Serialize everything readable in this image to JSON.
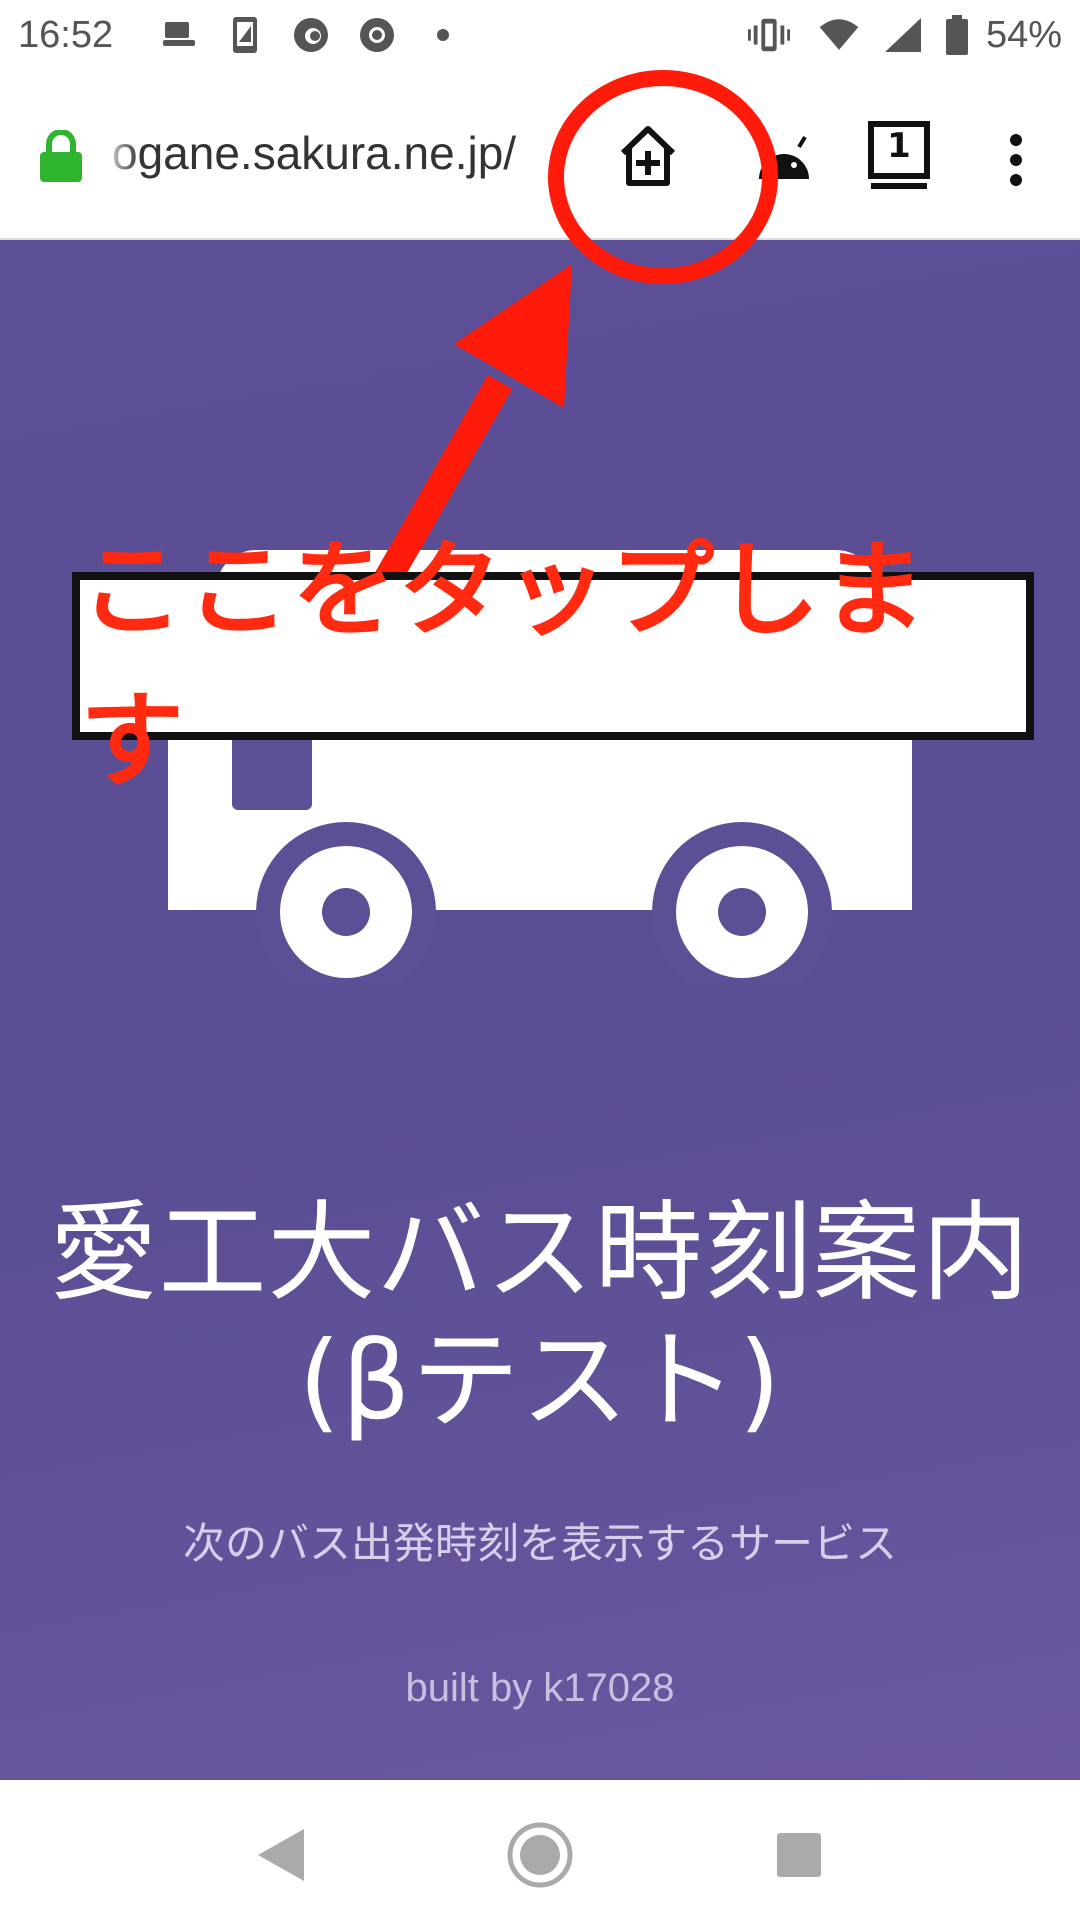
{
  "status_bar": {
    "time": "16:52",
    "battery": "54%",
    "icons": [
      "cast-icon",
      "phone-icon",
      "firefox-icon",
      "chrome-icon",
      "dot-icon",
      "vibrate-icon",
      "wifi-icon",
      "signal-icon",
      "battery-icon"
    ]
  },
  "browser": {
    "url": "ogane.sakura.ne.jp/",
    "tab_count": "1",
    "icons": [
      "lock-icon",
      "add-to-home-icon",
      "android-icon",
      "tab-switcher-icon",
      "more-menu-icon"
    ]
  },
  "page": {
    "title_line1": "愛工大バス時刻案内",
    "title_line2": "(βテスト)",
    "subtitle": "次のバス出発時刻を表示するサービス",
    "credit": "built by k17028"
  },
  "annotation": {
    "text": "ここをタップします",
    "color": "#ff1a0a"
  },
  "colors": {
    "page_background": "#5c4f96",
    "lock": "#2fb42f"
  },
  "nav_bar": {
    "icons": [
      "back-icon",
      "home-icon",
      "recents-icon"
    ]
  }
}
